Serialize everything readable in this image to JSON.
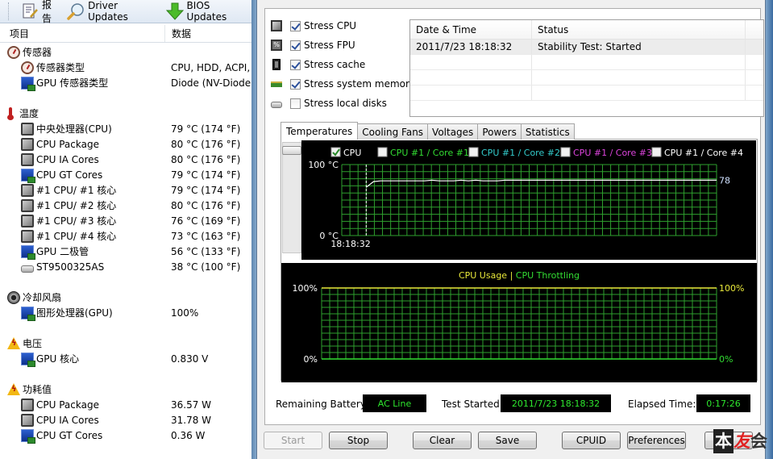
{
  "toolbar": {
    "items": [
      {
        "label": "报告",
        "icon": "report-icon"
      },
      {
        "label": "Driver Updates",
        "icon": "magnifier-icon"
      },
      {
        "label": "BIOS Updates",
        "icon": "download-arrow-icon"
      }
    ]
  },
  "sensor_list": {
    "columns": [
      "项目",
      "数据"
    ],
    "groups": [
      {
        "title": "传感器",
        "icon": "gauge-icon",
        "items": [
          {
            "name": "传感器类型",
            "value": "CPU, HDD, ACPI, S",
            "icon": "gauge-icon"
          },
          {
            "name": "GPU 传感器类型",
            "value": "Diode  (NV-Diode)",
            "icon": "gpu-icon"
          }
        ]
      },
      {
        "title": "温度",
        "icon": "thermometer-icon",
        "items": [
          {
            "name": "中央处理器(CPU)",
            "value": "79 °C  (174 °F)",
            "icon": "chip-icon"
          },
          {
            "name": "CPU Package",
            "value": "80 °C  (176 °F)",
            "icon": "chip-icon"
          },
          {
            "name": "CPU IA Cores",
            "value": "80 °C  (176 °F)",
            "icon": "chip-icon"
          },
          {
            "name": "CPU GT Cores",
            "value": "79 °C  (174 °F)",
            "icon": "gpu-icon"
          },
          {
            "name": "#1 CPU/ #1 核心",
            "value": "79 °C  (174 °F)",
            "icon": "chip-icon"
          },
          {
            "name": "#1 CPU/ #2 核心",
            "value": "80 °C  (176 °F)",
            "icon": "chip-icon"
          },
          {
            "name": "#1 CPU/ #3 核心",
            "value": "76 °C  (169 °F)",
            "icon": "chip-icon"
          },
          {
            "name": "#1 CPU/ #4 核心",
            "value": "73 °C  (163 °F)",
            "icon": "chip-icon"
          },
          {
            "name": "GPU 二极管",
            "value": "56 °C  (133 °F)",
            "icon": "gpu-icon"
          },
          {
            "name": "ST9500325AS",
            "value": "38 °C  (100 °F)",
            "icon": "disk-icon"
          }
        ]
      },
      {
        "title": "冷却风扇",
        "icon": "fan-icon",
        "items": [
          {
            "name": "图形处理器(GPU)",
            "value": "100%",
            "icon": "gpu-icon"
          }
        ]
      },
      {
        "title": "电压",
        "icon": "warning-icon",
        "items": [
          {
            "name": "GPU 核心",
            "value": "0.830 V",
            "icon": "gpu-icon"
          }
        ]
      },
      {
        "title": "功耗值",
        "icon": "warning-icon",
        "items": [
          {
            "name": "CPU Package",
            "value": "36.57 W",
            "icon": "chip-icon"
          },
          {
            "name": "CPU IA Cores",
            "value": "31.78 W",
            "icon": "chip-icon"
          },
          {
            "name": "CPU GT Cores",
            "value": "0.36 W",
            "icon": "gpu-icon"
          }
        ]
      }
    ]
  },
  "stress_options": [
    {
      "label": "Stress CPU",
      "checked": true,
      "icon": "cpu-icon"
    },
    {
      "label": "Stress FPU",
      "checked": true,
      "icon": "fpu-icon"
    },
    {
      "label": "Stress cache",
      "checked": true,
      "icon": "cache-icon"
    },
    {
      "label": "Stress system memory",
      "checked": true,
      "icon": "memory-icon"
    },
    {
      "label": "Stress local disks",
      "checked": false,
      "icon": "disk-icon"
    }
  ],
  "log": {
    "columns": [
      "Date & Time",
      "Status"
    ],
    "rows": [
      {
        "datetime": "2011/7/23 18:18:32",
        "status": "Stability Test: Started"
      }
    ]
  },
  "tabs": [
    {
      "label": "Temperatures",
      "active": true
    },
    {
      "label": "Cooling Fans",
      "active": false
    },
    {
      "label": "Voltages",
      "active": false
    },
    {
      "label": "Powers",
      "active": false
    },
    {
      "label": "Statistics",
      "active": false
    }
  ],
  "chart_data": [
    {
      "type": "line",
      "title": "Temperatures",
      "legend": [
        {
          "name": "CPU",
          "checked": true,
          "color": "#ffffff"
        },
        {
          "name": "CPU #1 / Core #1",
          "checked": false,
          "color": "#33dd33"
        },
        {
          "name": "CPU #1 / Core #2",
          "checked": false,
          "color": "#33cccc"
        },
        {
          "name": "CPU #1 / Core #3",
          "checked": false,
          "color": "#dd44dd"
        },
        {
          "name": "CPU #1 / Core #4",
          "checked": false,
          "color": "#ffffff"
        }
      ],
      "ylabel_top": "100 °C",
      "ylabel_bottom": "0 °C",
      "ylim": [
        0,
        100
      ],
      "grid": true,
      "marker_time": "18:18:32",
      "current_value_label": "78",
      "series": [
        {
          "name": "CPU",
          "values": [
            68,
            76,
            77,
            77,
            77,
            77,
            77,
            77,
            77,
            78,
            77,
            77,
            77,
            78,
            77,
            78,
            77,
            77,
            77,
            78,
            78,
            78,
            78,
            78,
            78,
            78,
            78,
            78,
            78,
            78,
            78,
            78,
            78,
            78,
            78,
            78,
            78,
            78,
            78,
            78,
            78,
            78,
            78,
            78,
            78,
            78,
            78,
            78,
            78
          ]
        }
      ]
    },
    {
      "type": "line",
      "title": "CPU Usage | CPU Throttling",
      "title_parts": [
        {
          "text": "CPU Usage",
          "color": "#e8e83a"
        },
        {
          "text": "|",
          "color": "#e8e83a"
        },
        {
          "text": "CPU Throttling",
          "color": "#33dd33"
        }
      ],
      "ylabels_left": [
        "100%",
        "0%"
      ],
      "ylabels_right": [
        "100%",
        "0%"
      ],
      "ylim": [
        0,
        100
      ],
      "grid": true,
      "series": [
        {
          "name": "CPU Usage",
          "color": "#e8e83a",
          "values": [
            100,
            100
          ]
        },
        {
          "name": "CPU Throttling",
          "color": "#33dd33",
          "values": [
            0,
            0
          ]
        }
      ]
    }
  ],
  "status": {
    "battery_label": "Remaining Battery:",
    "battery_value": "AC Line",
    "started_label": "Test Started:",
    "started_value": "2011/7/23 18:18:32",
    "elapsed_label": "Elapsed Time:",
    "elapsed_value": "0:17:26"
  },
  "buttons": {
    "start": "Start",
    "stop": "Stop",
    "clear": "Clear",
    "save": "Save",
    "cpuid": "CPUID",
    "preferences": "Preferences"
  },
  "watermark": [
    "本",
    "友",
    "会"
  ]
}
